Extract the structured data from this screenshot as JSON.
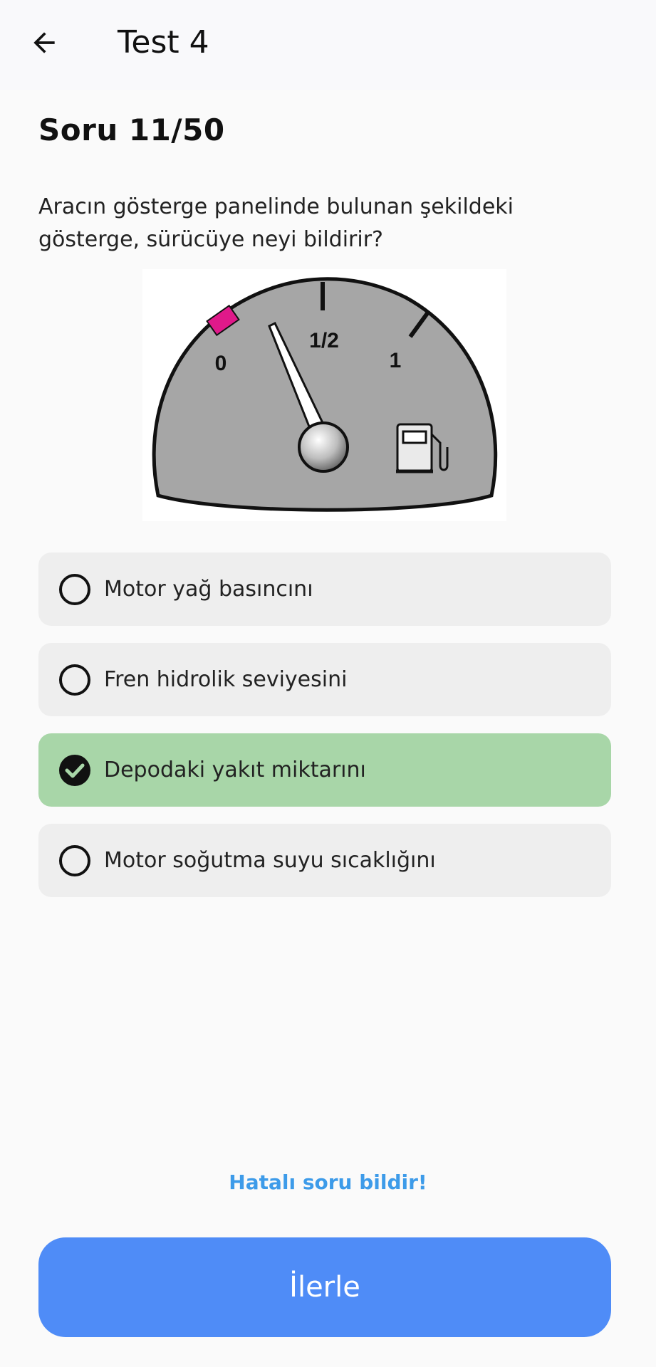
{
  "app_bar": {
    "back_icon": "arrow-left-icon",
    "title": "Test 4"
  },
  "question": {
    "counter": "Soru 11/50",
    "text": "Aracın gösterge panelinde bulunan şekildeki gösterge, sürücüye neyi bildirir?",
    "image": {
      "description_icon": "fuel-gauge-image",
      "scale_labels": [
        "0",
        "1/2",
        "1"
      ],
      "pointer_level": 0.15
    }
  },
  "answers": [
    {
      "label": "Motor yağ basıncını",
      "selected": false,
      "icon": "radio-unchecked-icon"
    },
    {
      "label": "Fren hidrolik seviyesini",
      "selected": false,
      "icon": "radio-unchecked-icon"
    },
    {
      "label": "Depodaki yakıt miktarını",
      "selected": true,
      "icon": "check-circle-icon"
    },
    {
      "label": "Motor soğutma suyu sıcaklığını",
      "selected": false,
      "icon": "radio-unchecked-icon"
    }
  ],
  "report_link": "Hatalı soru bildir!",
  "next_button": "İlerle",
  "colors": {
    "selected_answer": "#a8d6a8",
    "answer_bg": "#eeeeee",
    "primary_button": "#4f8cf7",
    "link": "#3d9be9",
    "gauge_marker": "#e0198a"
  }
}
